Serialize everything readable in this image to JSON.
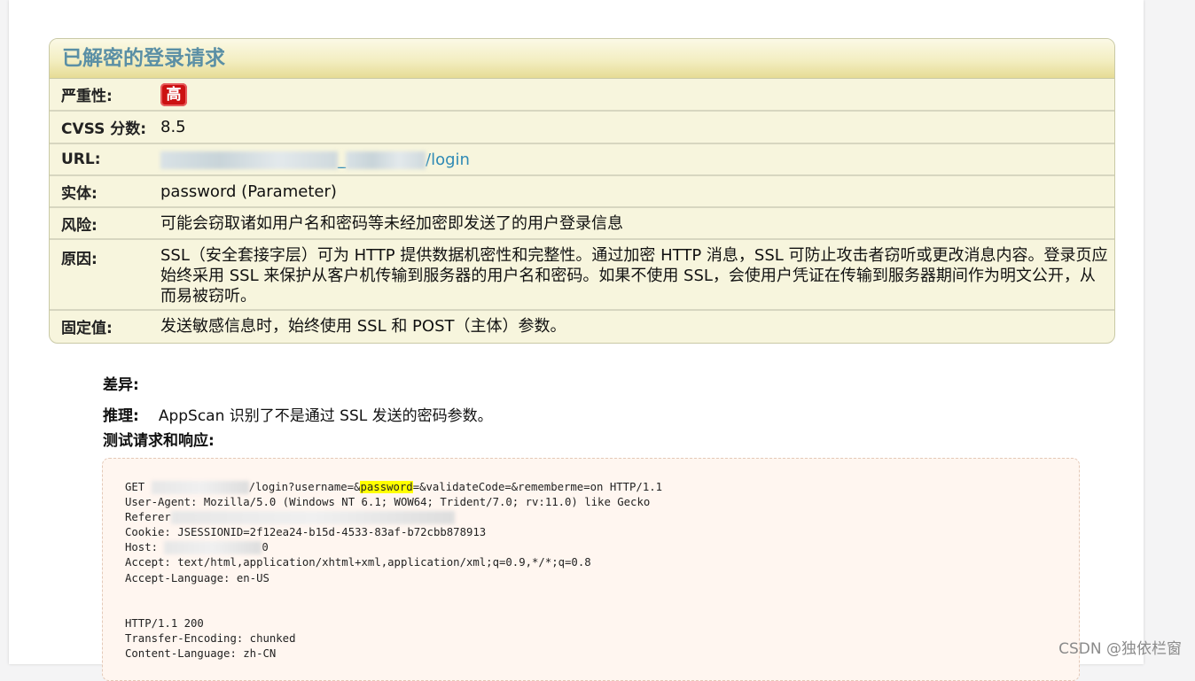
{
  "issue": {
    "title": "已解密的登录请求",
    "rows": {
      "severity_label": "严重性:",
      "severity_value": "高",
      "cvss_label": "CVSS 分数:",
      "cvss_value": "8.5",
      "url_label": "URL:",
      "url_value_visible": "_",
      "url_value_suffix": "/login",
      "entity_label": "实体:",
      "entity_value": "password (Parameter)",
      "risk_label": "风险:",
      "risk_value": "可能会窃取诸如用户名和密码等未经加密即发送了的用户登录信息",
      "cause_label": "原因:",
      "cause_value": "SSL（安全套接字层）可为 HTTP 提供数据机密性和完整性。通过加密 HTTP 消息，SSL 可防止攻击者窃听或更改消息内容。登录页应始终采用 SSL 来保护从客户机传输到服务器的用户名和密码。如果不使用 SSL，会使用户凭证在传输到服务器期间作为明文公开，从而易被窃听。",
      "fix_label": "固定值:",
      "fix_value": "发送敏感信息时，始终使用 SSL 和 POST（主体）参数。"
    }
  },
  "difference_label": "差异:",
  "reasoning_label": "推理:",
  "reasoning_value": "AppScan 识别了不是通过 SSL 发送的密码参数。",
  "test_label": "测试请求和响应:",
  "request": {
    "line1_prefix": "GET ",
    "line1_after_mask": "/login?username=&",
    "line1_highlight": "password",
    "line1_suffix": "=&validateCode=&rememberme=on HTTP/1.1",
    "user_agent": "User-Agent: Mozilla/5.0 (Windows NT 6.1; WOW64; Trident/7.0; rv:11.0) like Gecko",
    "referer_prefix": "Referer",
    "cookie": "Cookie: JSESSIONID=2f12ea24-b15d-4533-83af-b72cbb878913",
    "host_prefix": "Host: ",
    "host_suffix": "0",
    "accept": "Accept: text/html,application/xhtml+xml,application/xml;q=0.9,*/*;q=0.8",
    "accept_language": "Accept-Language: en-US"
  },
  "response": {
    "status": "HTTP/1.1 200",
    "transfer_encoding": "Transfer-Encoding: chunked",
    "content_language": "Content-Language: zh-CN"
  },
  "watermark": "CSDN @独依栏窗",
  "colors": {
    "title": "#5a8fa5",
    "severity_badge": "#cc1111",
    "link": "#2f8ab5",
    "highlight": "#ffff00"
  }
}
